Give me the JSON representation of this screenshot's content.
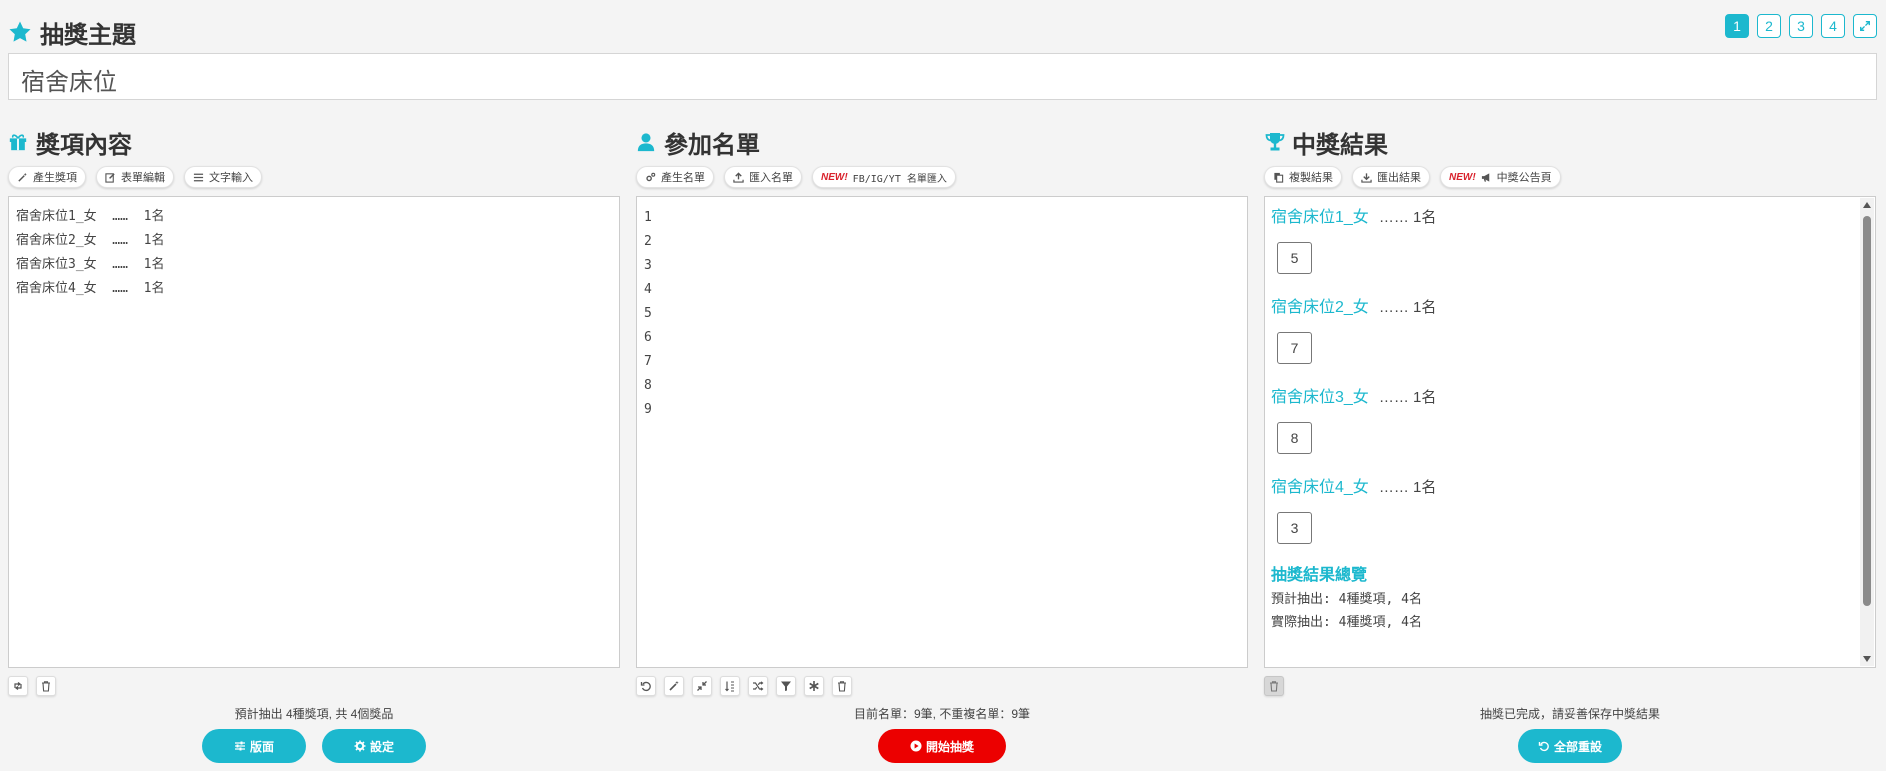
{
  "header": {
    "title": "抽獎主題",
    "pages": [
      "1",
      "2",
      "3",
      "4"
    ],
    "topic_value": "宿舍床位"
  },
  "prizes": {
    "title": "獎項內容",
    "tools": [
      "產生獎項",
      "表單編輯",
      "文字輸入"
    ],
    "lines": [
      "宿舍床位1_女  ……  1名",
      "宿舍床位2_女  ……  1名",
      "宿舍床位3_女  ……  1名",
      "宿舍床位4_女  ……  1名"
    ],
    "status": "預計抽出 4種獎項, 共 4個獎品",
    "layout_button": "版面",
    "settings_button": "設定"
  },
  "participants": {
    "title": "參加名單",
    "tools": [
      "產生名單",
      "匯入名單"
    ],
    "new_badge": "NEW!",
    "import_social": "FB/IG/YT 名單匯入",
    "names": [
      "1",
      "2",
      "3",
      "4",
      "5",
      "6",
      "7",
      "8",
      "9"
    ],
    "status": "目前名單：9筆, 不重複名單：9筆",
    "start_button": "開始抽獎"
  },
  "results": {
    "title": "中獎結果",
    "tools": [
      "複製結果",
      "匯出結果"
    ],
    "new_badge": "NEW!",
    "announce": "中獎公告頁",
    "groups": [
      {
        "prize": "宿舍床位1_女",
        "qty": "……  1名",
        "winner": "5"
      },
      {
        "prize": "宿舍床位2_女",
        "qty": "……  1名",
        "winner": "7"
      },
      {
        "prize": "宿舍床位3_女",
        "qty": "……  1名",
        "winner": "8"
      },
      {
        "prize": "宿舍床位4_女",
        "qty": "……  1名",
        "winner": "3"
      }
    ],
    "summary_title": "抽獎結果總覽",
    "summary_lines": [
      "預計抽出: 4種獎項, 4名",
      "實際抽出: 4種獎項, 4名"
    ],
    "status": "抽獎已完成，請妥善保存中獎結果",
    "reset_button": "全部重設"
  },
  "colors": {
    "accent": "#1cb8ce",
    "start": "#ec0000"
  }
}
